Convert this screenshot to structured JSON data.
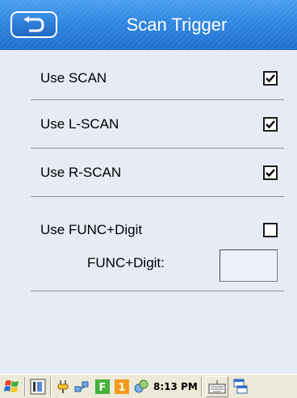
{
  "header": {
    "title": "Scan Trigger",
    "back_icon": "back-arrow-icon"
  },
  "settings": [
    {
      "label": "Use SCAN",
      "checked": true
    },
    {
      "label": "Use L-SCAN",
      "checked": true
    },
    {
      "label": "Use R-SCAN",
      "checked": true
    },
    {
      "label": "Use FUNC+Digit",
      "checked": false
    }
  ],
  "func_digit": {
    "label": "FUNC+Digit:",
    "value": ""
  },
  "taskbar": {
    "clock": "8:13 PM",
    "icons": [
      "start-flag-icon",
      "task-manager-icon",
      "power-plug-icon",
      "network-icon",
      "f-key-icon",
      "number-one-icon",
      "sync-icon",
      "keyboard-icon",
      "window-switch-icon"
    ]
  },
  "colors": {
    "titlebar": "#2f86e0",
    "background": "#e7ebf5",
    "taskbar": "#ece9d8"
  }
}
